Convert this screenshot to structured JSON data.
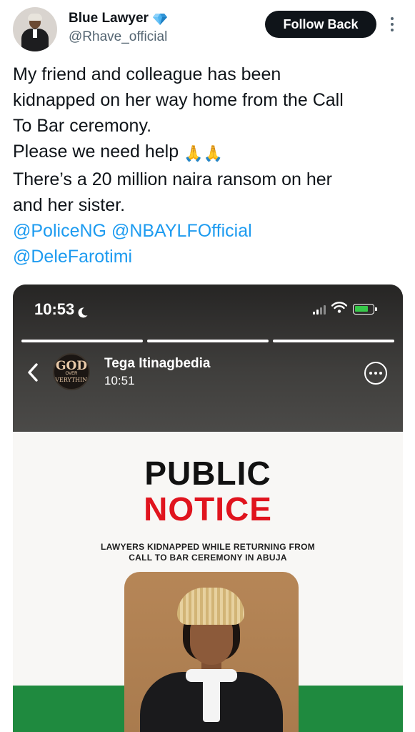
{
  "tweet": {
    "author": {
      "display_name": "Blue Lawyer",
      "handle": "@Rhave_official",
      "verified_badge": "blue-diamond-icon"
    },
    "follow_button_label": "Follow Back",
    "text_lines": [
      "My friend and colleague has been",
      "kidnapped on her way home from the Call",
      "To Bar ceremony.",
      "Please we need help",
      "There’s a 20 million naira ransom on her",
      "and her sister."
    ],
    "emoji": "🙏🙏",
    "mentions": [
      "@PoliceNG",
      "@NBAYLFOfficial",
      "@DeleFarotimi"
    ]
  },
  "story": {
    "status_time": "10:53",
    "user_name": "Tega Itinagbedia",
    "post_time": "10:51",
    "avatar_text": [
      "GOD",
      "OVER",
      "EVERYTHING"
    ],
    "progress_segments": 3,
    "poster": {
      "title_line1": "PUBLIC",
      "title_line2": "NOTICE",
      "subtitle_lines": [
        "LAWYERS KIDNAPPED WHILE RETURNING FROM",
        "CALL TO BAR CEREMONY IN ABUJA"
      ]
    }
  },
  "colors": {
    "mention": "#1d9bf0",
    "notice_red": "#e0141e",
    "green_band": "#1f8a3f",
    "follow_button": "#0f1419"
  }
}
